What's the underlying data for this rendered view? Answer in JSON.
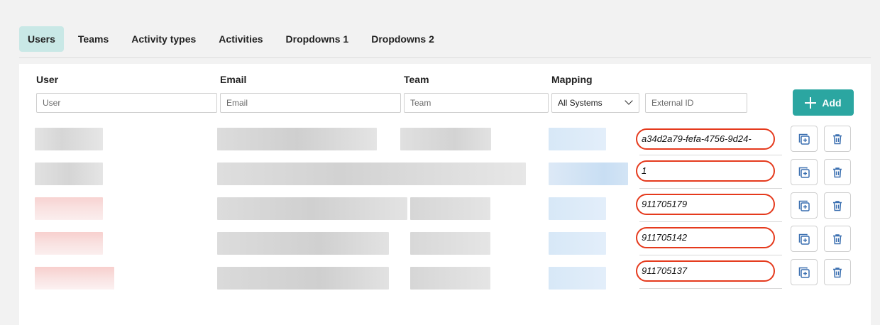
{
  "tabs": [
    {
      "label": "Users",
      "active": true
    },
    {
      "label": "Teams",
      "active": false
    },
    {
      "label": "Activity types",
      "active": false
    },
    {
      "label": "Activities",
      "active": false
    },
    {
      "label": "Dropdowns 1",
      "active": false
    },
    {
      "label": "Dropdowns 2",
      "active": false
    }
  ],
  "columns": {
    "user": "User",
    "email": "Email",
    "team": "Team",
    "mapping": "Mapping"
  },
  "filters": {
    "user_placeholder": "User",
    "email_placeholder": "Email",
    "team_placeholder": "Team",
    "mapping_selected": "All Systems",
    "external_id_placeholder": "External ID"
  },
  "add_button_label": "Add",
  "rows": [
    {
      "external_id": "a34d2a79-fefa-4756-9d24-"
    },
    {
      "external_id": "1"
    },
    {
      "external_id": "911705179"
    },
    {
      "external_id": "911705142"
    },
    {
      "external_id": "911705137"
    }
  ],
  "colors": {
    "accent": "#2ba6a1",
    "active_tab_bg": "#c9e8e6",
    "highlight_outline": "#e53a1d",
    "icon_blue": "#3a6fb0"
  },
  "icons": {
    "duplicate": "duplicate-icon",
    "delete": "trash-icon",
    "add": "plus-icon",
    "dropdown": "chevron-down-icon"
  }
}
